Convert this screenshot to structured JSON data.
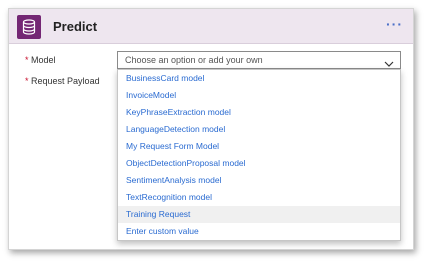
{
  "card": {
    "title": "Predict",
    "more_label": "···",
    "icon": "database-icon",
    "accent_color": "#742774",
    "header_bg": "#eee6ef"
  },
  "fields": {
    "model": {
      "required_mark": "*",
      "label": "Model",
      "placeholder": "Choose an option or add your own"
    },
    "request_payload": {
      "required_mark": "*",
      "label": "Request Payload"
    }
  },
  "dropdown": {
    "options": [
      "BusinessCard model",
      "InvoiceModel",
      "KeyPhraseExtraction model",
      "LanguageDetection model",
      "My Request Form Model",
      "ObjectDetectionProposal model",
      "SentimentAnalysis model",
      "TextRecognition model",
      "Training Request",
      "Enter custom value"
    ],
    "highlighted": "Training Request",
    "link_color": "#2a6bd1"
  }
}
